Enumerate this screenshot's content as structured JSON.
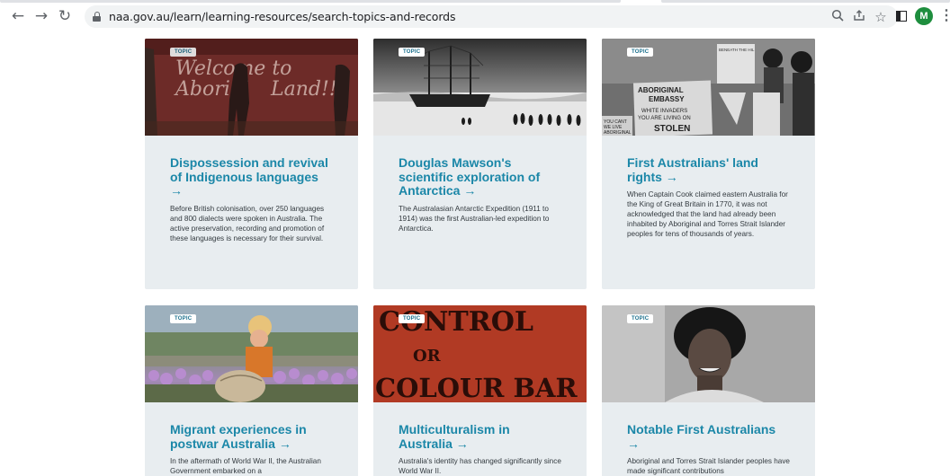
{
  "browser": {
    "url": "naa.gov.au/learn/learning-resources/search-topics-and-records",
    "avatar_letter": "M",
    "icons": [
      "back-arrow-icon",
      "forward-arrow-icon",
      "reload-icon",
      "lock-icon",
      "zoom-icon",
      "share-icon",
      "star-icon",
      "side-panel-icon",
      "kebab-menu-icon"
    ]
  },
  "image_text": {
    "lang_line1": "Welcome to",
    "lang_line2": "Aborigi",
    "lang_line3": "Land!!",
    "embassy_line1": "ABORIGINAL",
    "embassy_line2": "EMBASSY",
    "embassy_line3": "WHITE INVADERS",
    "embassy_line4": "YOU ARE LIVING ON",
    "embassy_line5": "STOLEN",
    "embassy_left1": "YOU CANT",
    "embassy_left2": "WE LIVE",
    "embassy_left3": "ABORIGINAL",
    "sign_right": "BENEATH THE HIL",
    "control1": "CONTROL",
    "control2": "OR",
    "control3": "COLOUR BAR"
  },
  "cards": [
    {
      "badge": "TOPIC",
      "title": "Dispossession and revival of Indigenous languages →",
      "description": "Before British colonisation, over 250 languages and 800 dialects were spoken in Australia. The active preservation, recording and promotion of these languages is necessary for their survival."
    },
    {
      "badge": "TOPIC",
      "title": "Douglas Mawson's scientific exploration of Antarctica →",
      "description": "The Australasian Antarctic Expedition (1911 to 1914) was the first Australian-led expedition to Antarctica."
    },
    {
      "badge": "TOPIC",
      "title": "First Australians' land rights →",
      "description": "When Captain Cook claimed eastern Australia for the King of Great Britain in 1770, it was not acknowledged that the land had already been inhabited by Aboriginal and Torres Strait Islander peoples for tens of thousands of years."
    },
    {
      "badge": "TOPIC",
      "title": "Migrant experiences in postwar Australia →",
      "description": "In the aftermath of World War II, the Australian Government embarked on a"
    },
    {
      "badge": "TOPIC",
      "title": "Multiculturalism in Australia →",
      "description": "Australia's identity has changed significantly since World War II."
    },
    {
      "badge": "TOPIC",
      "title": "Notable First Australians →",
      "description": "Aboriginal and Torres Strait Islander peoples have made significant contributions"
    }
  ]
}
